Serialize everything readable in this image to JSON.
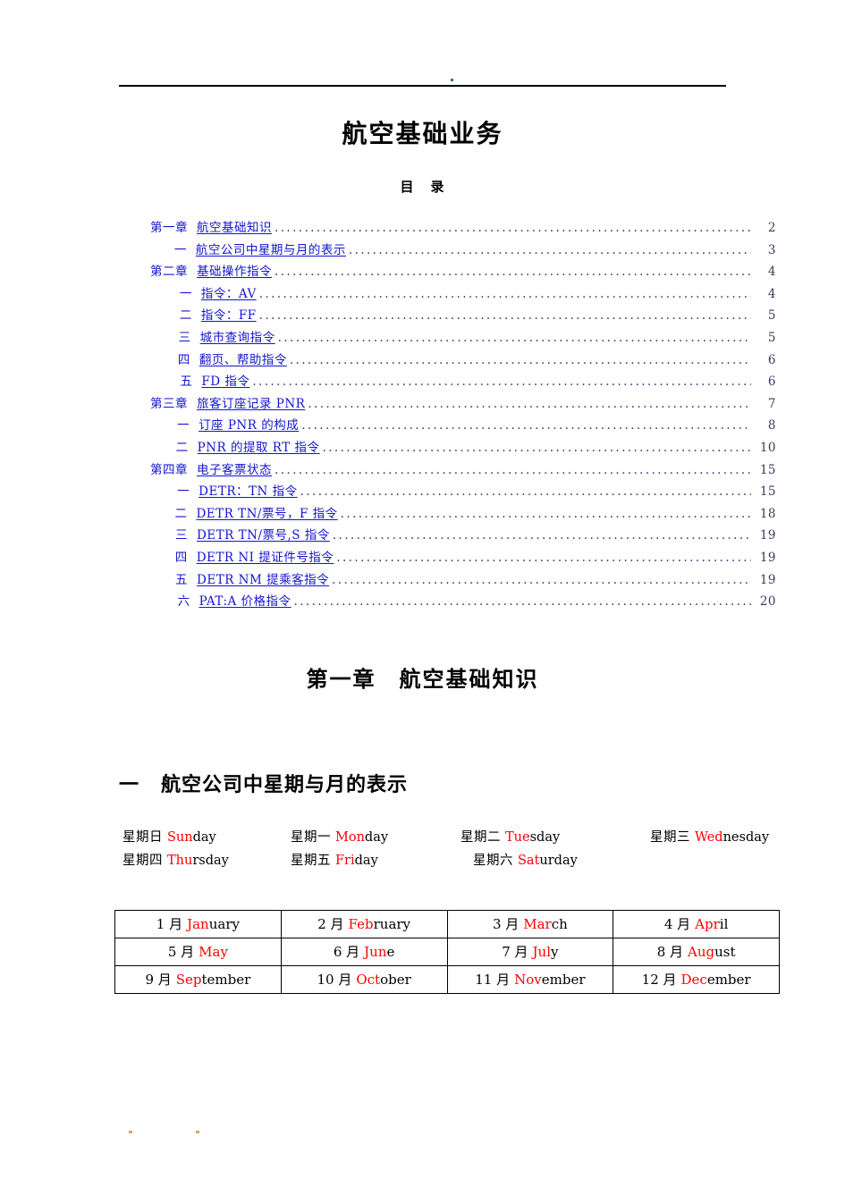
{
  "document": {
    "title": "航空基础业务",
    "toc_heading_left": "目",
    "toc_heading_right": "录"
  },
  "toc": {
    "entries": [
      {
        "level": 1,
        "num": "第一章",
        "label": "航空基础知识",
        "page": "2"
      },
      {
        "level": 2,
        "num": "一",
        "label": "航空公司中星期与月的表示",
        "page": "3"
      },
      {
        "level": 1,
        "num": "第二章",
        "label": "基础操作指令",
        "page": "4"
      },
      {
        "level": 2,
        "num": "一",
        "label": "指令：AV",
        "page": "4"
      },
      {
        "level": 2,
        "num": "二",
        "label": "指令：FF",
        "page": "5"
      },
      {
        "level": 2,
        "num": "三",
        "label": "城市查询指令",
        "page": "5"
      },
      {
        "level": 2,
        "num": "四",
        "label": "翻页、帮助指令",
        "page": "6"
      },
      {
        "level": 2,
        "num": "五",
        "label": "FD 指令",
        "page": "6"
      },
      {
        "level": 1,
        "num": "第三章",
        "label": "旅客订座记录 PNR",
        "page": "7"
      },
      {
        "level": 2,
        "num": "一",
        "label": "订座 PNR 的构成",
        "page": "8"
      },
      {
        "level": 2,
        "num": "二",
        "label": "PNR 的提取 RT 指令",
        "page": "10"
      },
      {
        "level": 1,
        "num": "第四章",
        "label": "电子客票状态",
        "page": "15"
      },
      {
        "level": 2,
        "num": "一",
        "label": "DETR：TN 指令",
        "page": "15"
      },
      {
        "level": 2,
        "num": "二",
        "label": "DETR TN/票号，F 指令",
        "page": "18"
      },
      {
        "level": 2,
        "num": "三",
        "label": "DETR TN/票号,S 指令",
        "page": "19"
      },
      {
        "level": 2,
        "num": "四",
        "label": "DETR NI 提证件号指令",
        "page": "19"
      },
      {
        "level": 2,
        "num": "五",
        "label": "DETR NM 提乘客指令",
        "page": "19"
      },
      {
        "level": 2,
        "num": "六",
        "label": "PAT:A 价格指令",
        "page": "20"
      }
    ]
  },
  "chapter": {
    "number": "第一章",
    "title": "航空基础知识"
  },
  "section": {
    "number": "一",
    "title": "航空公司中星期与月的表示"
  },
  "weekdays": {
    "rows": [
      [
        {
          "cn": "星期日",
          "en_red": "Sun",
          "en_black": "day"
        },
        {
          "cn": "星期一",
          "en_red": "Mon",
          "en_black": "day"
        },
        {
          "cn": "星期二",
          "en_red": "Tue",
          "en_black": "sday"
        },
        {
          "cn": "星期三",
          "en_red": "Wed",
          "en_black": "nesday"
        }
      ],
      [
        {
          "cn": "星期四",
          "en_red": "Thu",
          "en_black": "rsday"
        },
        {
          "cn": "星期五",
          "en_red": "Fri",
          "en_black": "day"
        },
        {
          "cn": "星期六",
          "en_red": "Sat",
          "en_black": "urday"
        }
      ]
    ]
  },
  "months": {
    "rows": [
      [
        {
          "cn": "1 月",
          "en_red": "Jan",
          "en_black": "uary"
        },
        {
          "cn": "2 月",
          "en_red": "Feb",
          "en_black": "ruary"
        },
        {
          "cn": "3 月",
          "en_red": "Mar",
          "en_black": "ch"
        },
        {
          "cn": "4 月",
          "en_red": "Apr",
          "en_black": "il"
        }
      ],
      [
        {
          "cn": "5 月",
          "en_red": "May",
          "en_black": ""
        },
        {
          "cn": "6 月",
          "en_red": "Jun",
          "en_black": "e"
        },
        {
          "cn": "7 月",
          "en_red": "Jul",
          "en_black": "y"
        },
        {
          "cn": "8 月",
          "en_red": "Aug",
          "en_black": "ust"
        }
      ],
      [
        {
          "cn": "9 月",
          "en_red": "Sep",
          "en_black": "tember"
        },
        {
          "cn": "10 月",
          "en_red": "Oct",
          "en_black": "ober"
        },
        {
          "cn": "11 月",
          "en_red": "Nov",
          "en_black": "ember"
        },
        {
          "cn": "12 月",
          "en_red": "Dec",
          "en_black": "ember"
        }
      ]
    ]
  },
  "colors": {
    "link": "#1414cf",
    "accent_red": "#ff0000",
    "text": "#000000"
  }
}
